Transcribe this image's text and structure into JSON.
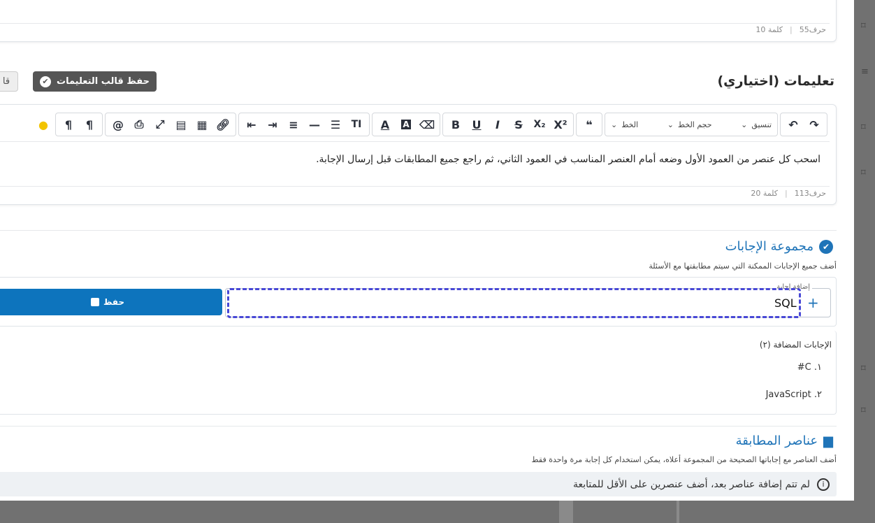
{
  "top_editor": {
    "char_count": "حرف55",
    "word_count": "كلمة 10"
  },
  "instructions": {
    "heading": "تعليمات (اختياري)",
    "save_template_label": "حفظ قالب التعليمات",
    "template_cut_label": "قا",
    "toolbar": {
      "format_label": "تنسيق",
      "font_size_label": "حجم الخط",
      "font_label": "الخط"
    },
    "text": "اسحب كل عنصر من العمود الأول وضعه أمام العنصر المناسب في العمود الثاني، ثم راجع جميع المطابقات قبل إرسال الإجابة.",
    "char_count": "حرف113",
    "word_count": "كلمة 20"
  },
  "answers": {
    "title": "مجموعة الإجابات",
    "subtitle": "أضف جميع الإجابات الممكنة التي سيتم مطابقتها مع الأسئلة",
    "input_legend": "إضافة إجابة",
    "input_value": "SQL",
    "save_label": "حفظ",
    "added_label": "الإجابات المضافة (٢)",
    "items": [
      "١. C#",
      "٢. JavaScript"
    ]
  },
  "matching": {
    "title": "عناصر المطابقة",
    "subtitle": "أضف العناصر مع إجاباتها الصحيحة من المجموعة أعلاه، يمكن استخدام كل إجابة مرة واحدة فقط",
    "notice": "لم تتم إضافة عناصر بعد، أضف عنصرين على الأقل للمتابعة"
  },
  "colors": {
    "accent": "#1f74b8",
    "save_button": "#0d74bd",
    "focus_ring": "#4848d6"
  }
}
